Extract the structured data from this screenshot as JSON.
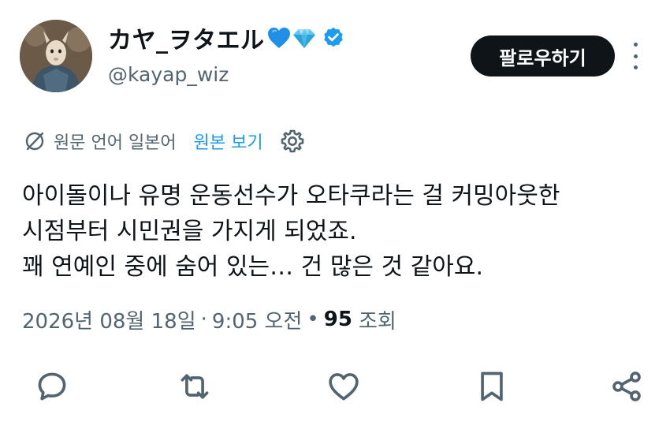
{
  "author": {
    "display_name": "カヤ_ヲタエル",
    "emojis": [
      "blue-heart",
      "gem"
    ],
    "verified": true,
    "handle": "@kayap_wiz"
  },
  "follow_button": {
    "label": "팔로우하기"
  },
  "translation": {
    "source_label": "원문 언어 일본어",
    "view_original_label": "원본 보기"
  },
  "tweet": {
    "lines": [
      "아이돌이나 유명 운동선수가 오타쿠라는 걸 커밍아웃한",
      "시점부터 시민권을 가지게 되었죠.",
      "꽤 연예인 중에 숨어 있는… 건 많은 것 같아요."
    ]
  },
  "meta": {
    "date": "2026년 08월 18일",
    "separator": "·",
    "time": "9:05 오전",
    "bullet": "•",
    "views_count": "95",
    "views_label": "조회"
  },
  "actions": [
    "reply-icon",
    "retweet-icon",
    "like-icon",
    "bookmark-icon",
    "share-icon"
  ],
  "colors": {
    "text": "#0f1419",
    "secondary": "#536471",
    "link": "#1d9bf0",
    "verified": "#1d9bf0",
    "follow_bg": "#0f1419"
  }
}
